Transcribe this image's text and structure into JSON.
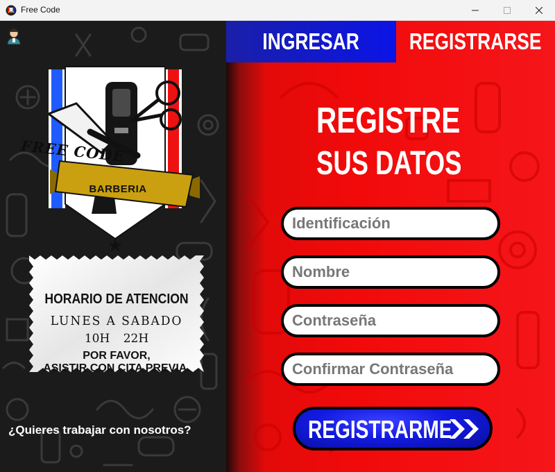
{
  "window": {
    "title": "Free Code",
    "icon": "barber-app-icon",
    "controls": {
      "minimize": "minimize-icon",
      "maximize": "maximize-icon",
      "close": "close-icon"
    }
  },
  "sidebar": {
    "user_icon": "user-avatar-icon",
    "logo": {
      "brand": "FREE CODE",
      "subtitle": "BARBERIA"
    },
    "hours": {
      "title": "HORARIO DE ATENCION",
      "days": "LUNES A SABADO",
      "time": "10H 22H",
      "note_line1": "POR FAVOR,",
      "note_line2": "ASISTIR CON CITA PREVIA."
    },
    "work_link": "¿Quieres trabajar con nosotros?"
  },
  "tabs": {
    "login": "INGRESAR",
    "register": "REGISTRARSE",
    "active": "register"
  },
  "form": {
    "heading_line1": "REGISTRE",
    "heading_line2": "SUS DATOS",
    "fields": [
      {
        "placeholder": "Identificación",
        "value": ""
      },
      {
        "placeholder": "Nombre",
        "value": ""
      },
      {
        "placeholder": "Contraseña",
        "value": ""
      },
      {
        "placeholder": "Confirmar Contraseña",
        "value": ""
      }
    ],
    "submit_label": "REGISTRARME",
    "submit_icon": "double-chevron-right-icon"
  },
  "colors": {
    "left_bg": "#1b1b1b",
    "right_bg": "#f20a0a",
    "tab_active_blue": "#0b14e6",
    "button_blue": "#121ae0"
  }
}
